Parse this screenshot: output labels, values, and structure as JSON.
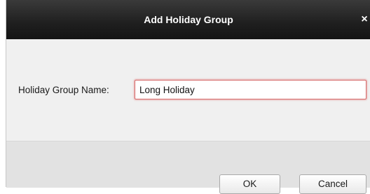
{
  "dialog": {
    "title": "Add Holiday Group",
    "close_glyph": "×",
    "close_icon": "close-icon"
  },
  "form": {
    "holiday_group_name_label": "Holiday Group Name:",
    "holiday_group_name_value": "Long Holiday"
  },
  "buttons": {
    "ok_label": "OK",
    "cancel_label": "Cancel"
  },
  "colors": {
    "titlebar": "#1f1f1f",
    "input_focus_border": "#d66a6a",
    "dialog_body": "#f0f0f0",
    "footer": "#e2e2e2"
  }
}
